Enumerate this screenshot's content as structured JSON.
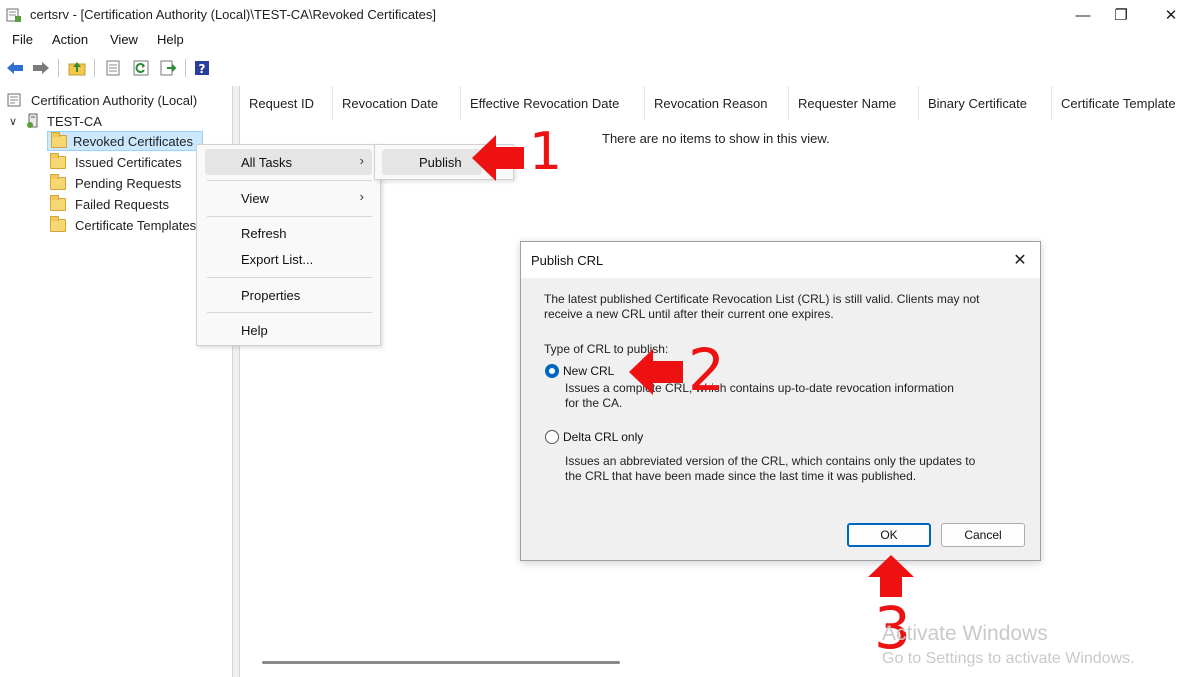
{
  "window": {
    "title": "certsrv - [Certification Authority (Local)\\TEST-CA\\Revoked Certificates]",
    "minimize_glyph": "—",
    "maximize_glyph": "❐",
    "close_glyph": "✕"
  },
  "menubar": [
    "File",
    "Action",
    "View",
    "Help"
  ],
  "toolbar": {
    "icons": [
      "back-arrow-icon",
      "forward-arrow-icon",
      "up-folder-icon",
      "properties-icon",
      "refresh-icon",
      "export-list-icon",
      "help-icon"
    ]
  },
  "tree": {
    "root": "Certification Authority (Local)",
    "ca": "TEST-CA",
    "expander": "∨",
    "items": [
      "Revoked Certificates",
      "Issued Certificates",
      "Pending Requests",
      "Failed Requests",
      "Certificate Templates"
    ],
    "selected_index": 0
  },
  "list": {
    "columns": [
      "Request ID",
      "Revocation Date",
      "Effective Revocation Date",
      "Revocation Reason",
      "Requester Name",
      "Binary Certificate",
      "Certificate Template"
    ],
    "empty_message": "There are no items to show in this view."
  },
  "context_menu": {
    "all_tasks": "All Tasks",
    "view": "View",
    "refresh": "Refresh",
    "export_list": "Export List...",
    "properties": "Properties",
    "help": "Help",
    "submenu_arrow": "›"
  },
  "submenu": {
    "publish": "Publish"
  },
  "dialog": {
    "title": "Publish CRL",
    "close_glyph": "✕",
    "message_line1": "The latest published Certificate Revocation List (CRL) is still valid. Clients may not",
    "message_line2": "receive a new CRL until after their current one expires.",
    "type_label": "Type of CRL to publish:",
    "option_new": "New CRL",
    "option_new_desc1": "Issues a complete CRL, which contains up-to-date revocation information",
    "option_new_desc2": "for the CA.",
    "option_delta": "Delta CRL only",
    "option_delta_desc1": "Issues an abbreviated version of the CRL, which contains only the updates to",
    "option_delta_desc2": "the CRL that have been made since the last time it was published.",
    "selected_option": "new",
    "ok": "OK",
    "cancel": "Cancel"
  },
  "annotations": {
    "step1": "1",
    "step2": "2",
    "step3": "3",
    "color": "#ee1111"
  },
  "watermark": {
    "line1": "Activate Windows",
    "line2": "Go to Settings to activate Windows."
  },
  "colors": {
    "selection": "#cce8ff",
    "accent": "#0067c0"
  }
}
